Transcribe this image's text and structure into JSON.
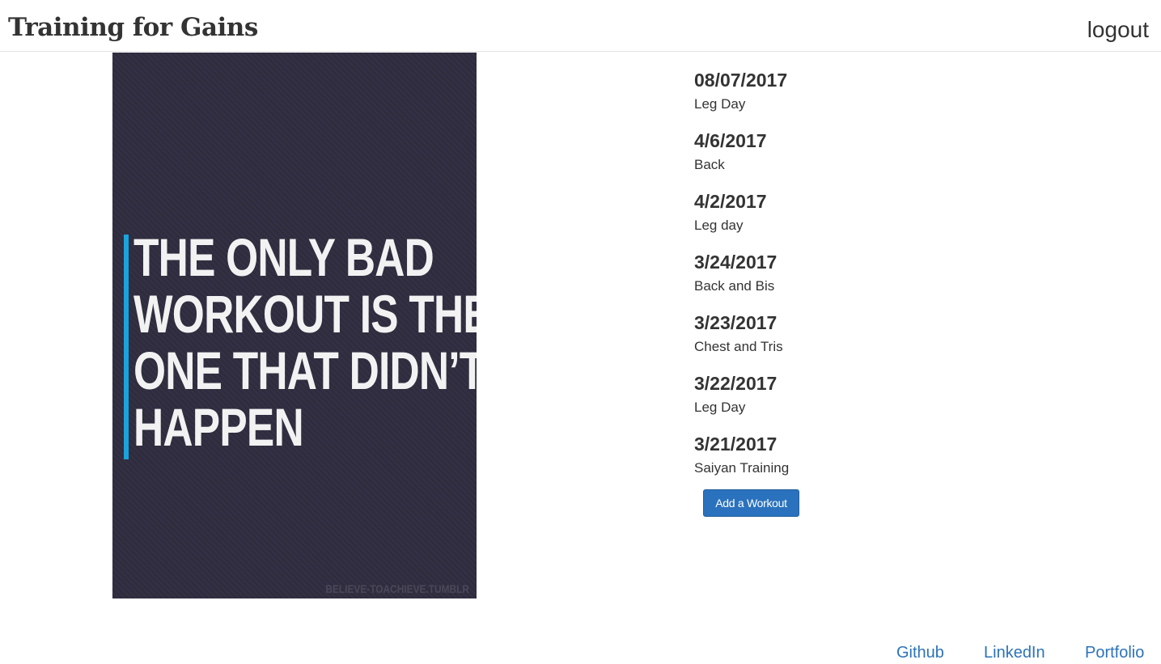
{
  "header": {
    "brand": "Training for Gains",
    "logout_label": "logout"
  },
  "poster": {
    "lines": [
      "THE ONLY BAD",
      "WORKOUT IS THE",
      "ONE THAT DIDN’T",
      "HAPPEN"
    ],
    "credit": "BELIEVE-TOACHIEVE.TUMBLR",
    "background_color": "#2e2c3e",
    "accent_color": "#1aa3dc"
  },
  "workouts": [
    {
      "date": "08/07/2017",
      "name": "Leg Day"
    },
    {
      "date": "4/6/2017",
      "name": "Back"
    },
    {
      "date": "4/2/2017",
      "name": "Leg day"
    },
    {
      "date": "3/24/2017",
      "name": "Back and Bis"
    },
    {
      "date": "3/23/2017",
      "name": "Chest and Tris"
    },
    {
      "date": "3/22/2017",
      "name": "Leg Day"
    },
    {
      "date": "3/21/2017",
      "name": "Saiyan Training"
    }
  ],
  "add_button_label": "Add a Workout",
  "footer": {
    "links": [
      "Github",
      "LinkedIn",
      "Portfolio"
    ],
    "link_color": "#2d73b8"
  },
  "colors": {
    "primary_button": "#2a72bd"
  }
}
